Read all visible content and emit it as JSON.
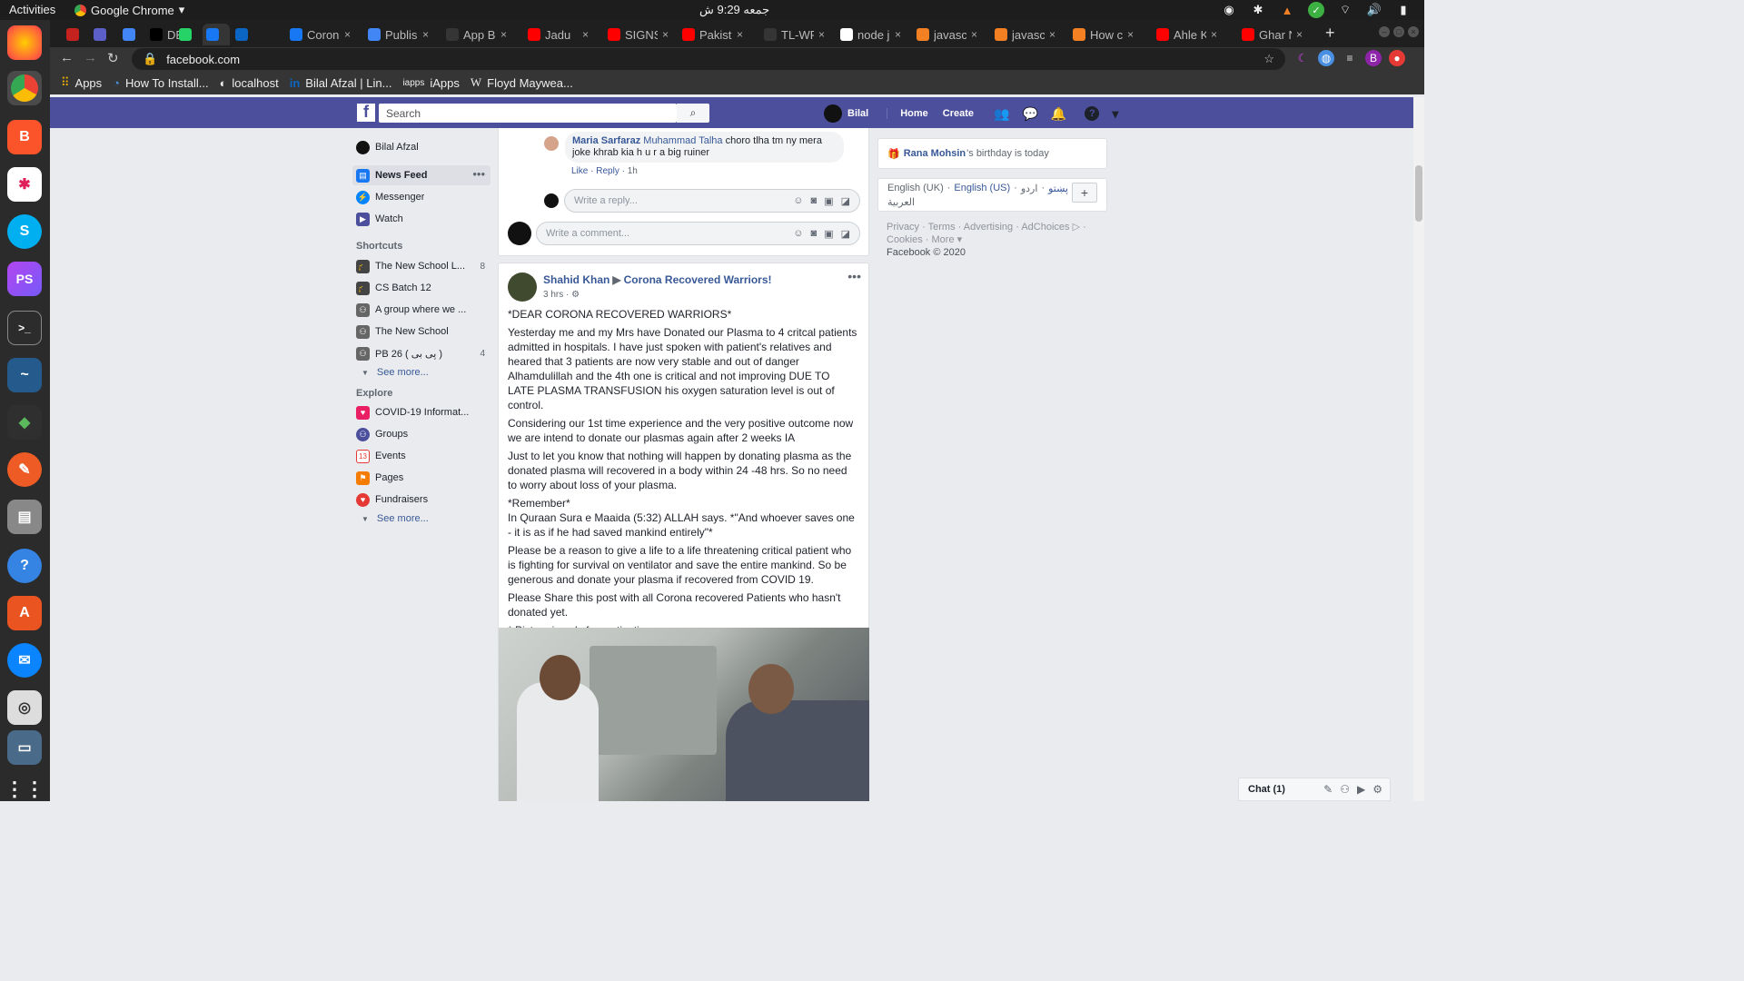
{
  "system": {
    "activities": "Activities",
    "app_name": "Google Chrome",
    "clock": "جمعه  9:29 ش"
  },
  "tabs": [
    {
      "label": "",
      "color": "#c5221f"
    },
    {
      "label": "",
      "color": "#5b5fc7"
    },
    {
      "label": "",
      "color": "#4285f4"
    },
    {
      "label": "DEV",
      "color": "#000000"
    },
    {
      "label": "",
      "color": "#25d366"
    },
    {
      "label": "",
      "color": "#1877f2"
    },
    {
      "label": "",
      "color": "#0a66c2"
    },
    {
      "label": "Coron",
      "color": "#1877f2"
    },
    {
      "label": "Publis",
      "color": "#4285f4"
    },
    {
      "label": "App B",
      "color": "#353535"
    },
    {
      "label": "Jadu",
      "color": "#ff0000"
    },
    {
      "label": "SIGNS",
      "color": "#ff0000"
    },
    {
      "label": "Pakist",
      "color": "#ff0000"
    },
    {
      "label": "TL-WR",
      "color": "#353535"
    },
    {
      "label": "node j",
      "color": "#ffffff"
    },
    {
      "label": "javasc",
      "color": "#f48024"
    },
    {
      "label": "javasc",
      "color": "#f48024"
    },
    {
      "label": "How c",
      "color": "#f48024"
    },
    {
      "label": "Ahle K",
      "color": "#ff0000"
    },
    {
      "label": "Ghar N",
      "color": "#ff0000"
    }
  ],
  "address": {
    "url": "facebook.com"
  },
  "bookmarks": [
    {
      "label": "Apps"
    },
    {
      "label": "How To Install..."
    },
    {
      "label": "localhost"
    },
    {
      "label": "Bilal Afzal | Lin..."
    },
    {
      "label": "iApps"
    },
    {
      "label": "Floyd Maywea..."
    }
  ],
  "fb_header": {
    "search_placeholder": "Search",
    "user": "Bilal",
    "home": "Home",
    "create": "Create"
  },
  "left_nav": {
    "user": "Bilal Afzal",
    "main": [
      {
        "label": "News Feed",
        "color": "#1877f2"
      },
      {
        "label": "Messenger",
        "color": "#0084ff"
      },
      {
        "label": "Watch",
        "color": "#4b4f9c"
      }
    ],
    "shortcuts_heading": "Shortcuts",
    "shortcuts": [
      {
        "label": "The New School L...",
        "count": "8"
      },
      {
        "label": "CS Batch 12",
        "count": ""
      },
      {
        "label": "A group where we ...",
        "count": ""
      },
      {
        "label": "The New School",
        "count": ""
      },
      {
        "label": "PB 26 ( پی بی )",
        "count": "4"
      }
    ],
    "see_more": "See more...",
    "explore_heading": "Explore",
    "explore": [
      {
        "label": "COVID-19 Informat...",
        "color": "#e91e63"
      },
      {
        "label": "Groups",
        "color": "#4b4f9c"
      },
      {
        "label": "Events",
        "color": "#e53935"
      },
      {
        "label": "Pages",
        "color": "#f57c00"
      },
      {
        "label": "Fundraisers",
        "color": "#e53935"
      }
    ],
    "see_more2": "See more..."
  },
  "comment": {
    "name": "Maria Sarfaraz",
    "mention": "Muhammad Talha",
    "text": "choro tlha tm ny mera joke khrab kia h u r a big ruiner",
    "like": "Like",
    "reply": "Reply",
    "time": "1h",
    "reply_placeholder": "Write a reply...",
    "comment_placeholder": "Write a comment..."
  },
  "post": {
    "author": "Shahid Khan",
    "group": "Corona Recovered Warriors!",
    "time": "3 hrs",
    "paragraphs": [
      "*DEAR CORONA RECOVERED WARRIORS*",
      "Yesterday me and my Mrs have Donated our Plasma to 4 critcal patients admitted in hospitals. I have just spoken with patient's relatives and heared that 3 patients are now very stable and out of danger Alhamdulillah and the 4th one is critical and not improving DUE TO LATE PLASMA TRANSFUSION his oxygen saturation level is out of control.",
      "Considering our 1st time experience and the very positive outcome now we are intend to donate our plasmas again after 2 weeks IA",
      "Just to let you know that nothing will happen by donating plasma as the donated plasma will recovered in a body within 24 -48 hrs. So no need to worry about loss of your plasma.",
      "*Remember*\nIn Quraan Sura e Maaida (5:32) ALLAH says. *\"And whoever saves one - it is as if he had saved mankind entirely\"*",
      "Please be a reason to give a life to a life threatening critical patient who is fighting for survival on ventilator and save the entire mankind. So be generous and donate your plasma if recovered from COVID 19.",
      "Please Share this post with all Corona recovered Patients who hasn't donated yet.",
      "* Picture is only for motivation."
    ]
  },
  "right_col": {
    "birthday_name": "Rana Mohsin",
    "birthday_text": "'s birthday is today",
    "lang1": "English (UK)",
    "lang2": "English (US)",
    "lang3": "اردو",
    "lang4": "پښتو",
    "lang5": "العربية",
    "footer_links": "Privacy · Terms · Advertising · AdChoices ▷ · Cookies · More ▾",
    "copyright": "Facebook © 2020"
  },
  "chat": {
    "label": "Chat (1)"
  },
  "icons": {
    "search": "search-icon",
    "friends": "friends-icon",
    "messenger": "messenger-icon",
    "notifications": "bell-icon",
    "help": "help-icon"
  }
}
